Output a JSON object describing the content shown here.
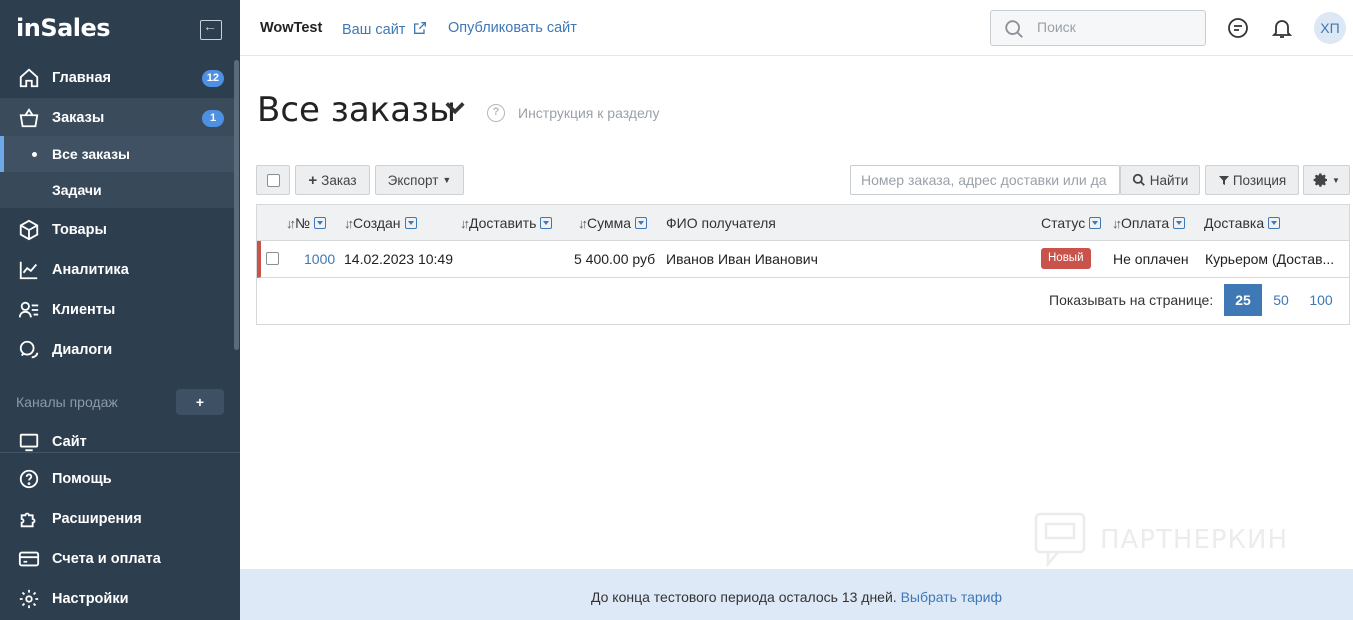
{
  "sidebar": {
    "logo": "inSales",
    "items": [
      {
        "label": "Главная",
        "badge": "12"
      },
      {
        "label": "Заказы",
        "badge": "1"
      },
      {
        "label": "Товары"
      },
      {
        "label": "Аналитика"
      },
      {
        "label": "Клиенты"
      },
      {
        "label": "Диалоги"
      },
      {
        "label": "Сайт"
      },
      {
        "label": "Помощь"
      },
      {
        "label": "Расширения"
      },
      {
        "label": "Счета и оплата"
      },
      {
        "label": "Настройки"
      }
    ],
    "sub_items": [
      {
        "label": "Все заказы"
      },
      {
        "label": "Задачи"
      }
    ],
    "channels_label": "Каналы продаж",
    "channels_add": "+"
  },
  "topbar": {
    "site_name": "WowTest",
    "your_site": "Ваш сайт",
    "publish": "Опубликовать сайт",
    "search_placeholder": "Поиск",
    "avatar": "ХП"
  },
  "main": {
    "title": "Все заказы",
    "help_label": "Инструкция к разделу",
    "toolbar": {
      "add_order": "Заказ",
      "export": "Экспорт",
      "filter_placeholder": "Номер заказа, адрес доставки или да",
      "find": "Найти",
      "position": "Позиция"
    },
    "table": {
      "headers": [
        "№",
        "Создан",
        "Доставить",
        "Сумма",
        "ФИО получателя",
        "Статус",
        "Оплата",
        "Доставка"
      ],
      "rows": [
        {
          "number": "1000",
          "created": "14.02.2023 10:49",
          "deliver": "",
          "sum": "5 400.00 руб",
          "recipient": "Иванов Иван Иванович",
          "status": "Новый",
          "payment": "Не оплачен",
          "delivery": "Курьером (Достав..."
        }
      ]
    },
    "pager": {
      "label": "Показывать на странице:",
      "options": [
        "25",
        "50",
        "100"
      ],
      "selected": "25"
    }
  },
  "footer": {
    "text": "До конца тестового периода осталось 13 дней.",
    "link": "Выбрать тариф"
  },
  "watermark": "ПАРТНЕРКИН",
  "colors": {
    "sidebar_bg": "#2d3e4f",
    "accent": "#3e78b5",
    "badge": "#4e90e2",
    "status_new": "#c9524a",
    "banner_bg": "#dde9f7"
  }
}
